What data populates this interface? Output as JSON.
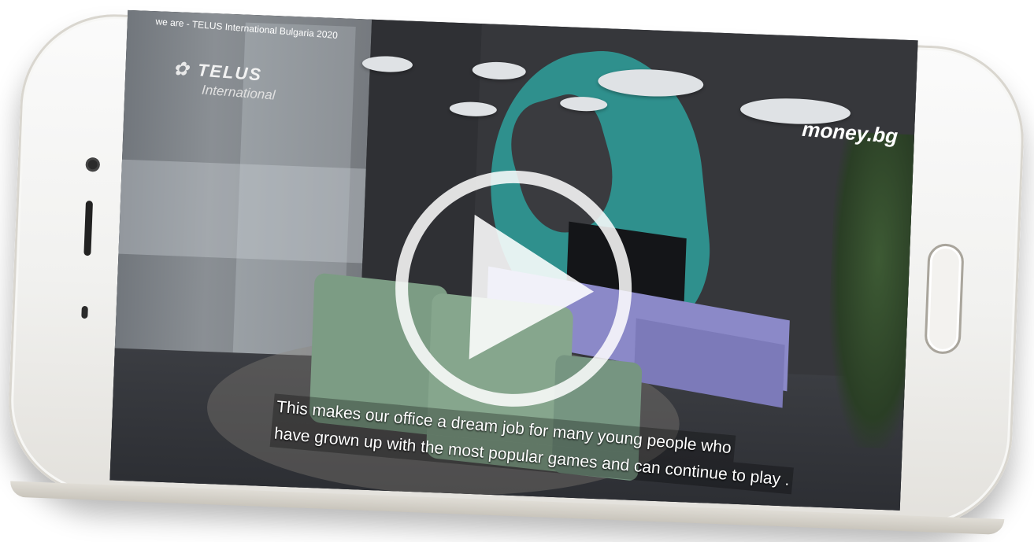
{
  "video": {
    "title": "we are - TELUS International Bulgaria 2020",
    "logo_main": "TELUS",
    "logo_sub": "International",
    "watermark": "money.bg",
    "subtitle_line1": "This makes our office a dream job for many  young people who",
    "subtitle_line2": "have grown up with the most popular games and can continue to play ."
  },
  "icons": {
    "play": "play-icon"
  },
  "colors": {
    "phone_body": "#f3f2ef",
    "accent_teal": "#2f9a97",
    "play_overlay": "#ffffff"
  }
}
